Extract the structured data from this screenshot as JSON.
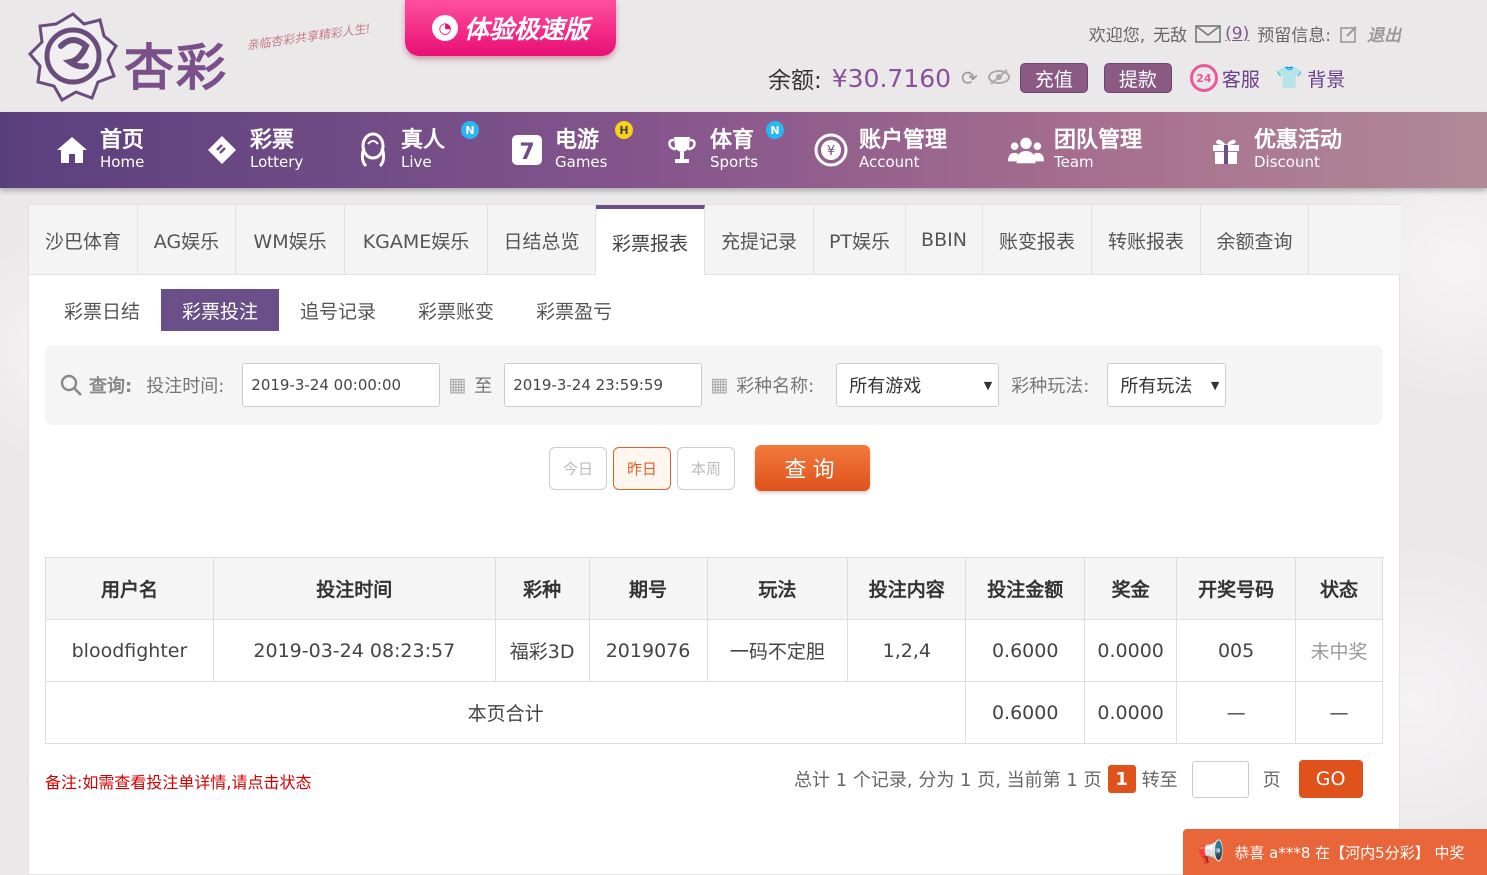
{
  "brand": {
    "name": "杏彩",
    "slogan": "亲临杏彩共享精彩人生!",
    "speed_banner": "体验极速版"
  },
  "user_bar": {
    "welcome": "欢迎您,",
    "username": "无敌",
    "mail_count": "(9)",
    "reserved_info_label": "预留信息:",
    "logout": "退出",
    "balance_label": "余额:",
    "balance_value": "¥30.7160",
    "recharge": "充值",
    "withdraw": "提款",
    "customer_service": "客服",
    "customer_service_icon_text": "24",
    "background": "背景"
  },
  "nav": [
    {
      "zh": "首页",
      "en": "Home",
      "icon": "home-icon"
    },
    {
      "zh": "彩票",
      "en": "Lottery",
      "icon": "lottery-ticket-icon"
    },
    {
      "zh": "真人",
      "en": "Live",
      "icon": "live-dealer-icon",
      "badge": "N"
    },
    {
      "zh": "电游",
      "en": "Games",
      "icon": "slot-seven-icon",
      "badge": "H"
    },
    {
      "zh": "体育",
      "en": "Sports",
      "icon": "trophy-icon",
      "badge": "N"
    },
    {
      "zh": "账户管理",
      "en": "Account",
      "icon": "account-coin-icon"
    },
    {
      "zh": "团队管理",
      "en": "Team",
      "icon": "team-icon"
    },
    {
      "zh": "优惠活动",
      "en": "Discount",
      "icon": "gift-icon"
    }
  ],
  "tabs": [
    "沙巴体育",
    "AG娱乐",
    "WM娱乐",
    "KGAME娱乐",
    "日结总览",
    "彩票报表",
    "充提记录",
    "PT娱乐",
    "BBIN",
    "账变报表",
    "转账报表",
    "余额查询"
  ],
  "active_tab": "彩票报表",
  "subtabs": [
    "彩票日结",
    "彩票投注",
    "追号记录",
    "彩票账变",
    "彩票盈亏"
  ],
  "active_subtab": "彩票投注",
  "query": {
    "search_label": "查询:",
    "time_label": "投注时间:",
    "start_time": "2019-3-24 00:00:00",
    "to": "至",
    "end_time": "2019-3-24 23:59:59",
    "game_label": "彩种名称:",
    "game_value": "所有游戏",
    "play_label": "彩种玩法:",
    "play_value": "所有玩法"
  },
  "quick": {
    "today": "今日",
    "yesterday": "昨日",
    "week": "本周",
    "search": "查询"
  },
  "table": {
    "headers": [
      "用户名",
      "投注时间",
      "彩种",
      "期号",
      "玩法",
      "投注内容",
      "投注金额",
      "奖金",
      "开奖号码",
      "状态"
    ],
    "rows": [
      [
        "bloodfighter",
        "2019-03-24 08:23:57",
        "福彩3D",
        "2019076",
        "一码不定胆",
        "1,2,4",
        "0.6000",
        "0.0000",
        "005",
        "未中奖"
      ]
    ],
    "subtotal": {
      "label": "本页合计",
      "amount": "0.6000",
      "bonus": "0.0000",
      "numbers": "—",
      "status": "—"
    }
  },
  "note": "备注:如需查看投注单详情,请点击状态",
  "pager": {
    "summary": "总计 1 个记录, 分为 1 页, 当前第 1 页",
    "current": "1",
    "goto": "转至",
    "page_unit": "页",
    "go": "GO"
  },
  "ticker": "恭喜 a***8 在【河内5分彩】 中奖"
}
